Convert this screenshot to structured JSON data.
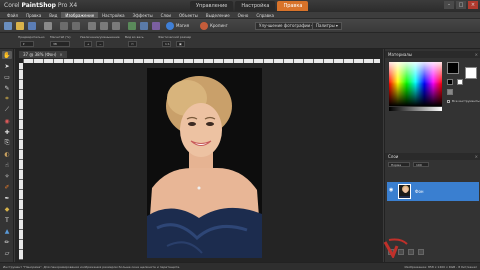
{
  "window": {
    "app_name_prefix": "Corel ",
    "app_name_main": "PaintShop",
    "app_name_suffix": " Pro X4",
    "workspace_tabs": [
      {
        "label": "Управление",
        "active": false
      },
      {
        "label": "Настройка",
        "active": false
      },
      {
        "label": "Правка",
        "active": true
      }
    ],
    "controls": [
      "–",
      "□",
      "×"
    ]
  },
  "menu": {
    "items": [
      {
        "label": "Файл",
        "active": false
      },
      {
        "label": "Правка",
        "active": false
      },
      {
        "label": "Вид",
        "active": false
      },
      {
        "label": "Изображение",
        "active": true
      },
      {
        "label": "Настройка",
        "active": false
      },
      {
        "label": "Эффекты",
        "active": false
      },
      {
        "label": "Слои",
        "active": false
      },
      {
        "label": "Объекты",
        "active": false
      },
      {
        "label": "Выделение",
        "active": false
      },
      {
        "label": "Окно",
        "active": false
      },
      {
        "label": "Справка",
        "active": false
      }
    ]
  },
  "toolbar": {
    "magic_label": "Магия",
    "crop_label": "Кропинг",
    "enhance_label": "Улучшение фотографии ▾",
    "palettes_label": "Палитры ▾"
  },
  "options": {
    "labels": [
      "Предварительно",
      "Масштаб (%):",
      "Увеличение/уменьшение",
      "Вид во весь",
      "Фактический размер"
    ],
    "zoom_value": "38"
  },
  "document": {
    "tab_title": "37 @ 38% (Фон)",
    "close": "×"
  },
  "palettes": {
    "materials_title": "Материалы",
    "all_tools_label": "Все инструменты",
    "layers_title": "Слои",
    "blend_mode": "Норма",
    "opacity": "100",
    "layer_name": "Фон"
  },
  "status": {
    "hint": "Инструмент \"Панорама\". Для панорамирования изображения размером больше окна щелкните и перетащите.",
    "info": "Изображение: 858 x 1400 x RGB - 8 бит/канал"
  },
  "colors": {
    "accent": "#d8732a",
    "layer_selected": "#3a7fd0"
  }
}
